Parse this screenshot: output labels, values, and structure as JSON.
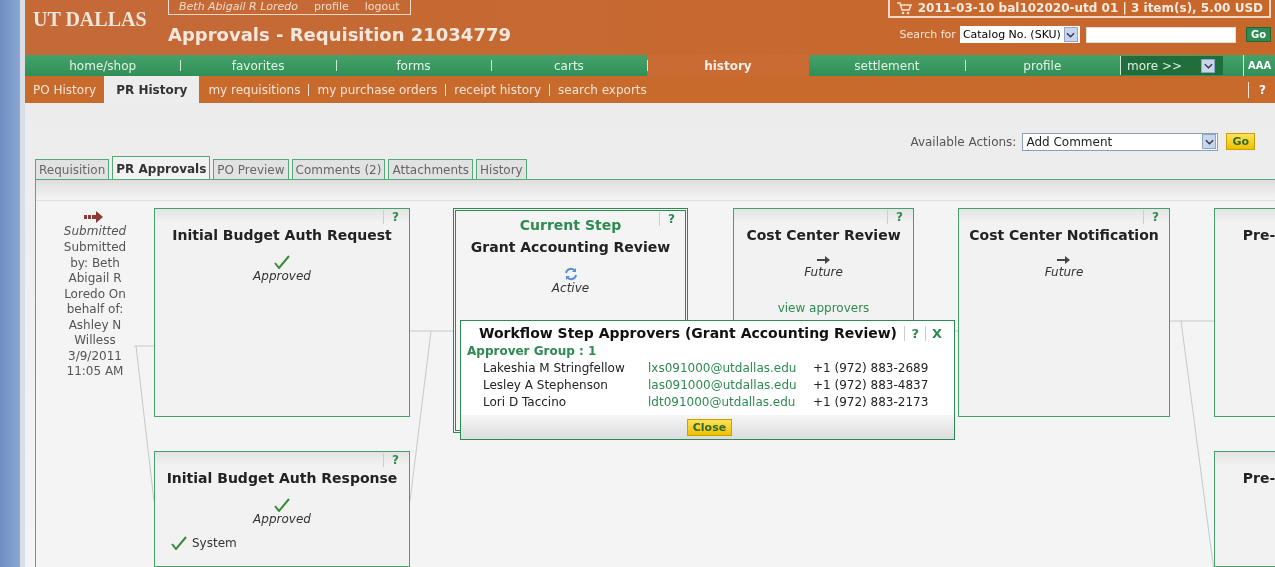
{
  "header": {
    "logo": "UT DALLAS",
    "user_links": [
      "Beth Abigail R Loredo",
      "profile",
      "logout"
    ],
    "title": "Approvals - Requisition 21034779",
    "cart_summary": "2011-03-10 bal102020-utd 01 | 3 item(s), 5.00 USD",
    "search": {
      "label": "Search for",
      "scope": "Catalog No. (SKU)",
      "button": "Go"
    }
  },
  "nav": {
    "items": [
      {
        "label": "home/shop",
        "selected": false
      },
      {
        "label": "favorites",
        "selected": false
      },
      {
        "label": "forms",
        "selected": false
      },
      {
        "label": "carts",
        "selected": false
      },
      {
        "label": "history",
        "selected": true
      },
      {
        "label": "settlement",
        "selected": false
      },
      {
        "label": "profile",
        "selected": false
      }
    ],
    "more": "more >>",
    "text_size": "AAA"
  },
  "subnav": {
    "items": [
      {
        "label": "PO History",
        "selected": false
      },
      {
        "label": "PR History",
        "selected": true
      },
      {
        "label": "my requisitions",
        "selected": false
      },
      {
        "label": "my purchase orders",
        "selected": false
      },
      {
        "label": "receipt history",
        "selected": false
      },
      {
        "label": "search exports",
        "selected": false
      }
    ],
    "help": "?"
  },
  "actions": {
    "label": "Available Actions:",
    "value": "Add Comment",
    "button": "Go"
  },
  "tabs": [
    {
      "label": "Requisition",
      "selected": false
    },
    {
      "label": "PR Approvals",
      "selected": true
    },
    {
      "label": "PO Preview",
      "selected": false
    },
    {
      "label": "Comments (2)",
      "selected": false
    },
    {
      "label": "Attachments",
      "selected": false
    },
    {
      "label": "History",
      "selected": false
    }
  ],
  "submitted": {
    "status": "Submitted",
    "details": "Submitted by: Beth Abigail R Loredo On behalf of: Ashley N Willess 3/9/2011 11:05 AM"
  },
  "steps": [
    {
      "title": "Initial Budget Auth Request",
      "current": false,
      "help": "?",
      "kind": "approved",
      "status_label": "Approved"
    },
    {
      "title": "Grant Accounting Review",
      "current": true,
      "current_label": "Current Step",
      "help": "?",
      "kind": "active",
      "status_label": "Active"
    },
    {
      "title": "Cost Center Review",
      "current": false,
      "help": "?",
      "kind": "future",
      "status_label": "Future",
      "link": "view approvers"
    },
    {
      "title": "Cost Center Notification",
      "current": false,
      "help": "?",
      "kind": "future",
      "status_label": "Future"
    },
    {
      "title": "Pre-",
      "current": false
    },
    {
      "title": "Initial Budget Auth Response",
      "current": false,
      "help": "?",
      "kind": "approved",
      "status_label": "Approved",
      "approver": "System"
    },
    {
      "title": "Pre-",
      "current": false
    }
  ],
  "popup": {
    "title": "Workflow Step Approvers (Grant Accounting Review)",
    "help": "?",
    "close_icon": "X",
    "group": "Approver Group : 1",
    "approvers": [
      {
        "name": "Lakeshia M Stringfellow",
        "email": "lxs091000@utdallas.edu",
        "phone": "+1 (972) 883-2689"
      },
      {
        "name": "Lesley A Stephenson",
        "email": "las091000@utdallas.edu",
        "phone": "+1 (972) 883-4837"
      },
      {
        "name": "Lori D Taccino",
        "email": "ldt091000@utdallas.edu",
        "phone": "+1 (972) 883-2173"
      }
    ],
    "button": "Close"
  }
}
